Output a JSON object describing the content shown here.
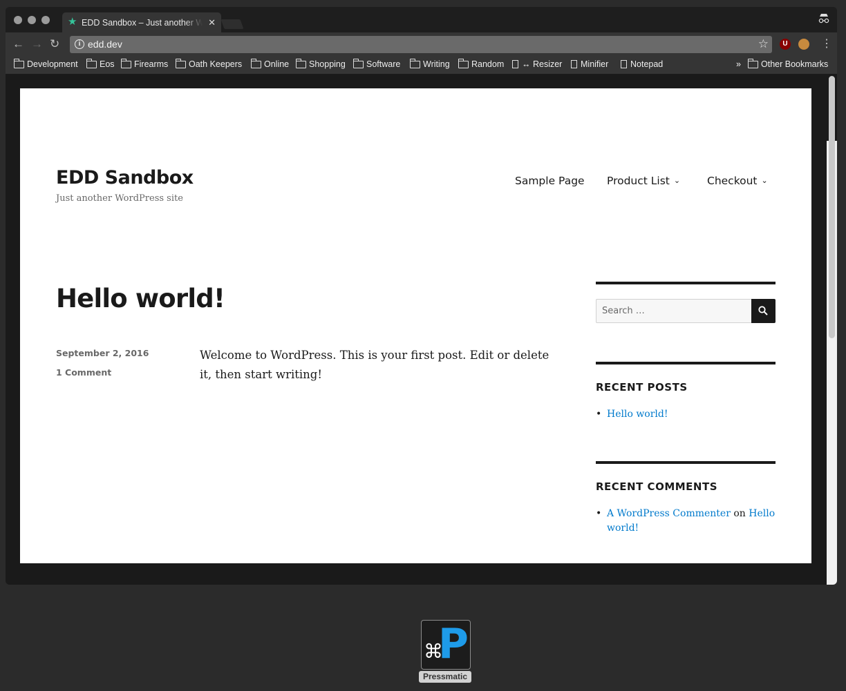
{
  "browser": {
    "tab_title": "EDD Sandbox – Just another WordPress site",
    "tab_close": "✕",
    "url": "edd.dev",
    "bookmarks": [
      {
        "label": "Development",
        "type": "folder"
      },
      {
        "label": "Eos",
        "type": "folder"
      },
      {
        "label": "Firearms",
        "type": "folder"
      },
      {
        "label": "Oath Keepers",
        "type": "folder"
      },
      {
        "label": "Online",
        "type": "folder"
      },
      {
        "label": "Shopping",
        "type": "folder"
      },
      {
        "label": "Software",
        "type": "folder"
      },
      {
        "label": "Writing",
        "type": "folder"
      },
      {
        "label": "Random",
        "type": "folder"
      },
      {
        "label": "↔ Resizer",
        "type": "page"
      },
      {
        "label": "Minifier",
        "type": "page"
      },
      {
        "label": "Notepad",
        "type": "page"
      }
    ],
    "overflow_label": "»",
    "other_bookmarks": "Other Bookmarks"
  },
  "site": {
    "title": "EDD Sandbox",
    "description": "Just another WordPress site",
    "nav": [
      {
        "label": "Sample Page",
        "has_submenu": false
      },
      {
        "label": "Product List",
        "has_submenu": true
      },
      {
        "label": "Checkout",
        "has_submenu": true
      }
    ]
  },
  "post": {
    "title": "Hello world!",
    "date": "September 2, 2016",
    "comments_link": "1 Comment",
    "body": "Welcome to WordPress. This is your first post. Edit or delete it, then start writing!"
  },
  "sidebar": {
    "search_placeholder": "Search …",
    "recent_posts_title": "RECENT POSTS",
    "recent_posts": [
      "Hello world!"
    ],
    "recent_comments_title": "RECENT COMMENTS",
    "recent_comment": {
      "author": "A WordPress Commenter",
      "on": "on",
      "post": "Hello world!"
    }
  },
  "dock": {
    "app_label": "Pressmatic"
  },
  "colors": {
    "link": "#007acc",
    "tab_favicon": "#35c49a",
    "app_accent": "#1e9be9"
  }
}
